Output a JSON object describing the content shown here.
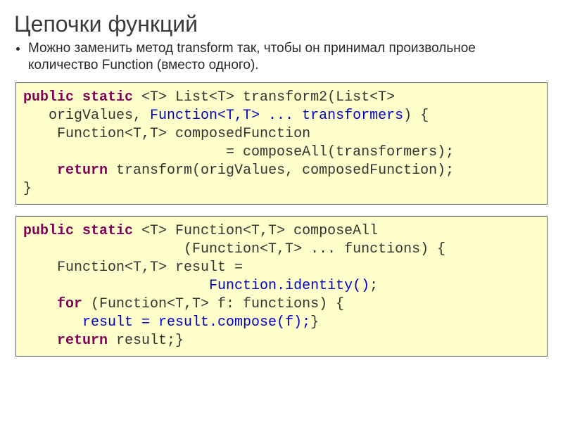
{
  "title": "Цепочки функций",
  "bullet": "Можно заменить метод transform так, чтобы он принимал произвольное количество Function (вместо одного).",
  "code1": {
    "kw_pubstat": "public static",
    "sig_a": " <T> List<T> transform2(List<T>",
    "line2_a": "   origValues, ",
    "blue_param": "Function<T,T> ... transformers",
    "line2_b": ") {",
    "line3": "    Function<T,T> composedFunction",
    "line4": "                        = composeAll(transformers);",
    "kw_return": "    return",
    "line5": " transform(origValues, composedFunction);",
    "line6": "}"
  },
  "code2": {
    "kw_pubstat": "public static",
    "sig_a": " <T> Function<T,T> composeAll",
    "line2": "                   (Function<T,T> ... functions) {",
    "line3": "    Function<T,T> result =",
    "blue_ident_pad": "                      ",
    "blue_ident": "Function.identity()",
    "blue_ident_end": ";",
    "kw_for": "    for",
    "line5_a": " (Function<T,T> f: functions) {",
    "blue_comp_pad": "       ",
    "blue_comp": "result = result.compose(f);",
    "line6_end": "}",
    "kw_return": "    return",
    "line7": " result;}"
  }
}
